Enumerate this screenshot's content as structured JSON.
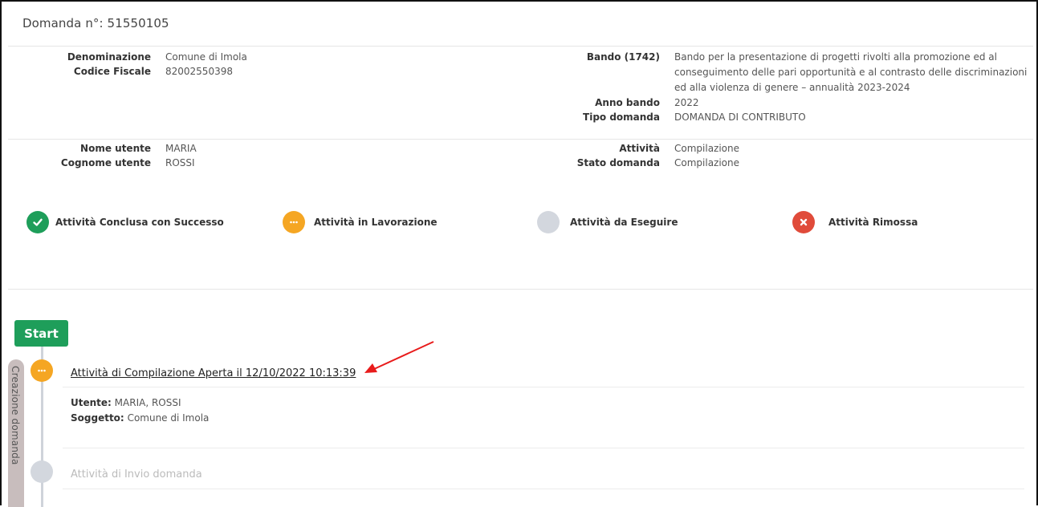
{
  "header": {
    "title": "Domanda n°: 51550105"
  },
  "applicant": {
    "denominazione_label": "Denominazione",
    "denominazione_value": "Comune di Imola",
    "codice_fiscale_label": "Codice Fiscale",
    "codice_fiscale_value": "82002550398"
  },
  "bando": {
    "label": "Bando (1742)",
    "value": "Bando per la presentazione di progetti rivolti alla promozione ed al conseguimento delle pari opportunità e al contrasto delle discriminazioni ed alla violenza di genere – annualità 2023-2024",
    "anno_label": "Anno bando",
    "anno_value": "2022",
    "tipo_label": "Tipo domanda",
    "tipo_value": "DOMANDA DI CONTRIBUTO"
  },
  "user": {
    "nome_label": "Nome utente",
    "nome_value": "MARIA",
    "cognome_label": "Cognome utente",
    "cognome_value": "ROSSI"
  },
  "status": {
    "attivita_label": "Attività",
    "attivita_value": "Compilazione",
    "stato_label": "Stato domanda",
    "stato_value": "Compilazione"
  },
  "legend": [
    {
      "label": "Attività Conclusa con Successo",
      "icon": "check-icon",
      "color": "#1e9e5a"
    },
    {
      "label": "Attività in Lavorazione",
      "icon": "ellipsis-icon",
      "color": "#f5a623"
    },
    {
      "label": "Attività da Eseguire",
      "icon": "empty-circle-icon",
      "color": "#d3d7de"
    },
    {
      "label": "Attività Rimossa",
      "icon": "x-icon",
      "color": "#e04b3a"
    }
  ],
  "timeline": {
    "start_label": "Start",
    "phase_label": "Creazione domanda",
    "activities": [
      {
        "title": "Attività di Compilazione Aperta il 12/10/2022 10:13:39",
        "utente_label": "Utente:",
        "utente_value": "MARIA, ROSSI",
        "soggetto_label": "Soggetto:",
        "soggetto_value": "Comune di Imola",
        "status_color": "#f5a623"
      },
      {
        "title": "Attività di Invio domanda",
        "status_color": "#d3d7de"
      }
    ]
  },
  "colors": {
    "success": "#1e9e5a",
    "working": "#f5a623",
    "todo": "#d3d7de",
    "removed": "#e04b3a",
    "annotation_arrow": "#e81b1b"
  }
}
